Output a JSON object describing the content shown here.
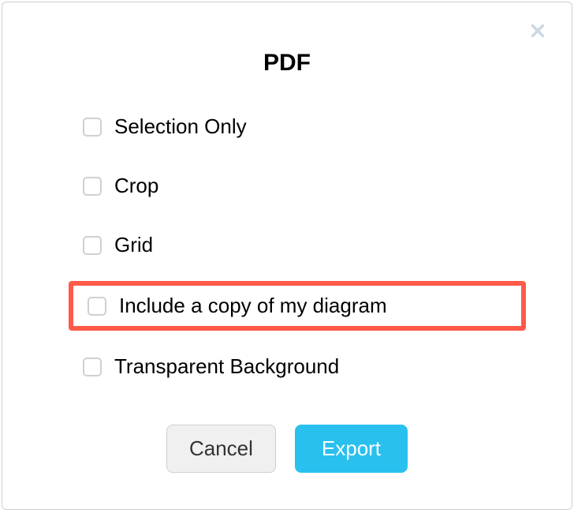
{
  "dialog": {
    "title": "PDF",
    "options": [
      {
        "label": "Selection Only",
        "checked": false,
        "highlighted": false
      },
      {
        "label": "Crop",
        "checked": false,
        "highlighted": false
      },
      {
        "label": "Grid",
        "checked": false,
        "highlighted": false
      },
      {
        "label": "Include a copy of my diagram",
        "checked": false,
        "highlighted": true
      },
      {
        "label": "Transparent Background",
        "checked": false,
        "highlighted": false
      }
    ],
    "buttons": {
      "cancel": "Cancel",
      "export": "Export"
    }
  }
}
